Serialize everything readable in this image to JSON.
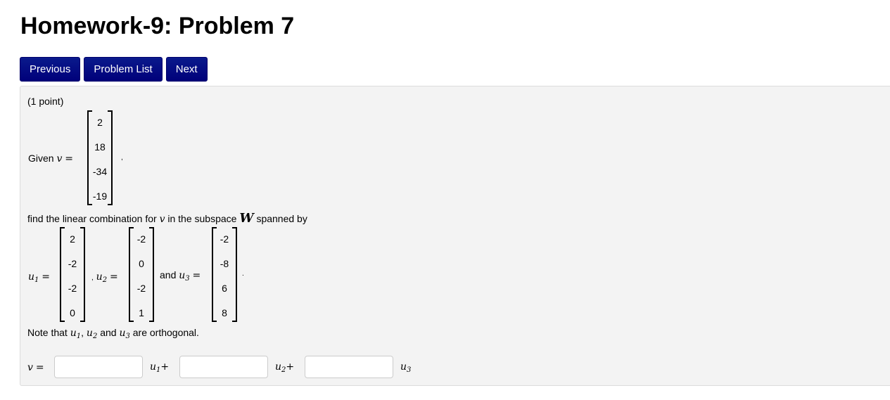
{
  "page_title": "Homework-9: Problem 7",
  "nav": {
    "previous": "Previous",
    "problem_list": "Problem List",
    "next": "Next"
  },
  "problem": {
    "points": "(1 point)",
    "given_label": "Given",
    "v_symbol": "v",
    "equals": "=",
    "comma": ",",
    "v_vector": [
      "2",
      "18",
      "-34",
      "-19"
    ],
    "find_text_1": "find the linear combination for",
    "find_text_2": "in the subspace",
    "W_symbol": "W",
    "find_text_3": "spanned by",
    "u1_label": "u",
    "u1_vector": [
      "2",
      "-2",
      "-2",
      "0"
    ],
    "u2_vector": [
      "-2",
      "0",
      "-2",
      "1"
    ],
    "u3_vector": [
      "-2",
      "-8",
      "6",
      "8"
    ],
    "and_text": "and",
    "period": ".",
    "note_prefix": "Note that",
    "note_and": "and",
    "note_suffix": "are orthogonal.",
    "sub1": "1",
    "sub2": "2",
    "sub3": "3",
    "plus": "+",
    "answers": {
      "coef_u1": "",
      "coef_u2": "",
      "coef_u3": ""
    }
  }
}
